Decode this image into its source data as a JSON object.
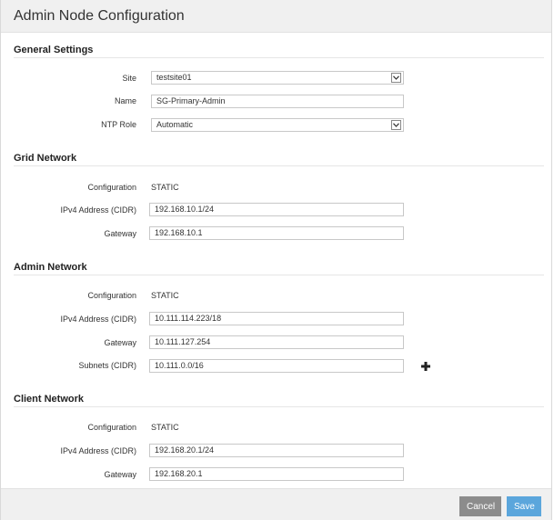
{
  "dialog": {
    "title": "Admin Node Configuration"
  },
  "general": {
    "title": "General Settings",
    "site_label": "Site",
    "site_value": "testsite01",
    "name_label": "Name",
    "name_value": "SG-Primary-Admin",
    "ntp_label": "NTP Role",
    "ntp_value": "Automatic"
  },
  "grid": {
    "title": "Grid Network",
    "config_label": "Configuration",
    "config_value": "STATIC",
    "ipv4_label": "IPv4 Address (CIDR)",
    "ipv4_value": "192.168.10.1/24",
    "gateway_label": "Gateway",
    "gateway_value": "192.168.10.1"
  },
  "admin": {
    "title": "Admin Network",
    "config_label": "Configuration",
    "config_value": "STATIC",
    "ipv4_label": "IPv4 Address (CIDR)",
    "ipv4_value": "10.111.114.223/18",
    "gateway_label": "Gateway",
    "gateway_value": "10.111.127.254",
    "subnets_label": "Subnets (CIDR)",
    "subnets_value": "10.111.0.0/16"
  },
  "client": {
    "title": "Client Network",
    "config_label": "Configuration",
    "config_value": "STATIC",
    "ipv4_label": "IPv4 Address (CIDR)",
    "ipv4_value": "192.168.20.1/24",
    "gateway_label": "Gateway",
    "gateway_value": "192.168.20.1"
  },
  "footer": {
    "cancel_label": "Cancel",
    "save_label": "Save"
  },
  "colors": {
    "save": "#5ba6dc",
    "cancel": "#8c8c8c",
    "header_bg": "#f0f0f0"
  },
  "icons": {
    "select_arrow": "chevron-down-icon",
    "add_subnet": "plus-icon"
  }
}
